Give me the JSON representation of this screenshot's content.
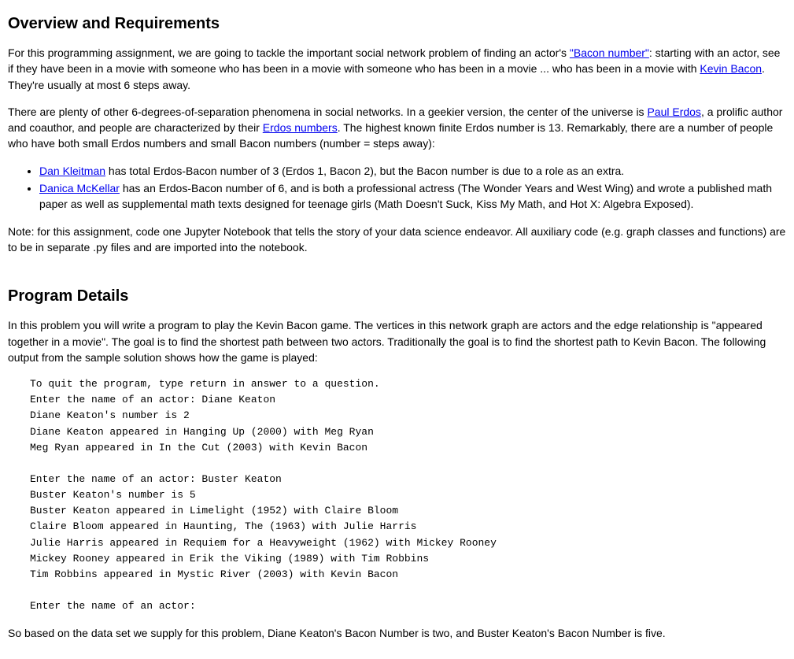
{
  "overview": {
    "heading": "Overview and Requirements",
    "p1_a": "For this programming assignment, we are going to tackle the important social network problem of finding an actor's ",
    "link_bacon": "\"Bacon number\"",
    "p1_b": ": starting with an actor, see if they have been in a movie with someone who has been in a movie with someone who has been in a movie ... who has been in a movie with ",
    "link_kevin": "Kevin Bacon",
    "p1_c": ". They're usually at most 6 steps away.",
    "p2_a": "There are plenty of other 6-degrees-of-separation phenomena in social networks. In a geekier version, the center of the universe is ",
    "link_paul": "Paul Erdos",
    "p2_b": ", a prolific author and coauthor, and people are characterized by their ",
    "link_erdos_num": "Erdos numbers",
    "p2_c": ". The highest known finite Erdos number is 13. Remarkably, there are a number of people who have both small Erdos numbers and small Bacon numbers (number = steps away):",
    "li1_link": "Dan Kleitman",
    "li1_text": " has total Erdos-Bacon number of 3 (Erdos 1, Bacon 2), but the Bacon number is due to a role as an extra.",
    "li2_link": "Danica McKellar",
    "li2_text": " has an Erdos-Bacon number of 6, and is both a professional actress (The Wonder Years and West Wing) and wrote a published math paper as well as supplemental math texts designed for teenage girls (Math Doesn't Suck, Kiss My Math, and Hot X: Algebra Exposed).",
    "note": "Note: for this assignment, code one Jupyter Notebook that tells the story of your data science endeavor. All auxiliary code (e.g. graph classes and functions) are to be in separate .py files and are imported into the notebook."
  },
  "details": {
    "heading": "Program Details",
    "p1": "In this problem you will write a program to play the Kevin Bacon game. The vertices in this network graph are actors and the edge relationship is \"appeared together in a movie\". The goal is to find the shortest path between two actors. Traditionally the goal is to find the shortest path to Kevin Bacon. The following output from the sample solution shows how the game is played:",
    "sample_output": "To quit the program, type return in answer to a question.\nEnter the name of an actor: Diane Keaton\nDiane Keaton's number is 2\nDiane Keaton appeared in Hanging Up (2000) with Meg Ryan\nMeg Ryan appeared in In the Cut (2003) with Kevin Bacon\n\nEnter the name of an actor: Buster Keaton\nBuster Keaton's number is 5\nBuster Keaton appeared in Limelight (1952) with Claire Bloom\nClaire Bloom appeared in Haunting, The (1963) with Julie Harris\nJulie Harris appeared in Requiem for a Heavyweight (1962) with Mickey Rooney\nMickey Rooney appeared in Erik the Viking (1989) with Tim Robbins\nTim Robbins appeared in Mystic River (2003) with Kevin Bacon\n\nEnter the name of an actor:",
    "p2": "So based on the data set we supply for this problem, Diane Keaton's Bacon Number is two, and Buster Keaton's Bacon Number is five."
  }
}
